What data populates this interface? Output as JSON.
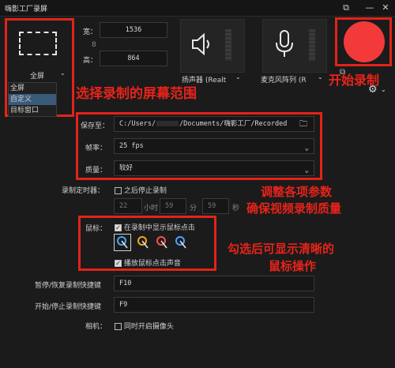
{
  "window": {
    "title": "嗨影工厂录屏"
  },
  "region": {
    "mode_selected": "全屏",
    "options": [
      "全屏",
      "自定义",
      "目标窗口"
    ],
    "width_label": "宽：",
    "height_label": "高：",
    "width_value": "1536",
    "height_value": "864",
    "link_glyph": "8"
  },
  "audio": {
    "speaker_label": "扬声器 (Realt",
    "mic_label": "麦克风阵列 (R"
  },
  "settings": {
    "save_label": "保存至：",
    "save_path_prefix": "C:/Users/",
    "save_path_suffix": "/Documents/嗨影工厂/Recorded",
    "fps_label": "帧率：",
    "fps_value": "25 fps",
    "quality_label": "质量：",
    "quality_value": "较好",
    "timer_label": "录制定时器：",
    "timer_check": "之后停止录制",
    "hours_value": "22",
    "hours_unit": "小时",
    "minutes_value": "59",
    "minutes_unit": "分",
    "seconds_value": "59",
    "seconds_unit": "秒",
    "mouse_label": "鼠标：",
    "show_clicks": "在录制中显示鼠标点击",
    "play_click_sound": "播放鼠标点击声音",
    "pause_hotkey_label": "暂停/恢复录制快捷键",
    "pause_hotkey_value": "F10",
    "startstop_hotkey_label": "开始/停止录制快捷键",
    "startstop_hotkey_value": "F9",
    "camera_label": "相机：",
    "camera_check": "同时开启摄像头"
  },
  "annotations": {
    "start_record": "开始录制",
    "select_range": "选择录制的屏幕范围",
    "adjust_line1": "调整各项参数",
    "adjust_line2": "确保视频录制质量",
    "mouse_line1": "勾选后可显示清晰的",
    "mouse_line2": "鼠标操作"
  },
  "colors": {
    "accent_red": "#e2231a",
    "record_button": "#f23a3a",
    "background": "#1b1b1b"
  },
  "icons": {
    "speaker": "speaker-icon",
    "mic": "microphone-icon",
    "folder": "folder-icon",
    "settings": "gear-icon",
    "cursor": "cursor-click-icon"
  }
}
